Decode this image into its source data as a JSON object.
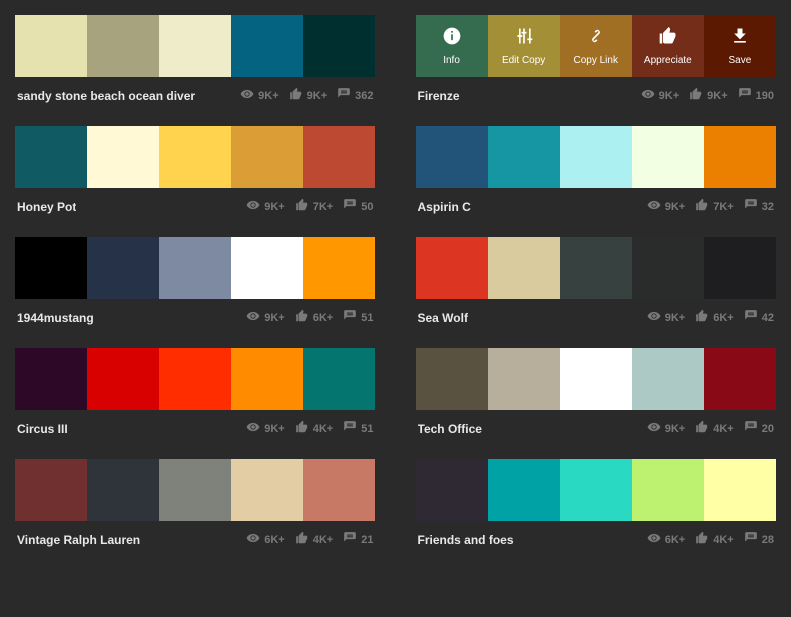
{
  "overlay": {
    "info": "Info",
    "edit": "Edit Copy",
    "copy": "Copy Link",
    "appreciate": "Appreciate",
    "save": "Save"
  },
  "palettes": [
    {
      "title": "sandy stone beach ocean diver",
      "views": "9K+",
      "likes": "9K+",
      "comments": "362",
      "colors": [
        "#e6e2af",
        "#a7a37e",
        "#efecca",
        "#046380",
        "#002f2f"
      ],
      "hover": false
    },
    {
      "title": "Firenze",
      "views": "9K+",
      "likes": "9K+",
      "comments": "190",
      "colors": [
        "#468966",
        "#fff0a5",
        "#ffb03b",
        "#b64926",
        "#8e2800"
      ],
      "hover": true,
      "ov_colors": [
        "#356b4e",
        "#a38f36",
        "#a06f24",
        "#732d18",
        "#5a1900"
      ]
    },
    {
      "title": "Honey Pot",
      "views": "9K+",
      "likes": "7K+",
      "comments": "50",
      "colors": [
        "#105b63",
        "#fffad5",
        "#ffd34e",
        "#db9e36",
        "#bd4932"
      ],
      "hover": false
    },
    {
      "title": "Aspirin C",
      "views": "9K+",
      "likes": "7K+",
      "comments": "32",
      "colors": [
        "#225378",
        "#1695a3",
        "#acf0f2",
        "#f3ffe2",
        "#eb7f00"
      ],
      "hover": false
    },
    {
      "title": "1944mustang",
      "views": "9K+",
      "likes": "6K+",
      "comments": "51",
      "colors": [
        "#000000",
        "#263248",
        "#7e8aa2",
        "#ffffff",
        "#ff9800"
      ],
      "hover": false
    },
    {
      "title": "Sea Wolf",
      "views": "9K+",
      "likes": "6K+",
      "comments": "42",
      "colors": [
        "#dc3522",
        "#d9cb9e",
        "#374140",
        "#2a2c2b",
        "#1e1e20"
      ],
      "hover": false
    },
    {
      "title": "Circus III",
      "views": "9K+",
      "likes": "4K+",
      "comments": "51",
      "colors": [
        "#2e0927",
        "#d90000",
        "#ff2d00",
        "#ff8c00",
        "#04756f"
      ],
      "hover": false
    },
    {
      "title": "Tech Office",
      "views": "9K+",
      "likes": "4K+",
      "comments": "20",
      "colors": [
        "#595241",
        "#b8ae9c",
        "#ffffff",
        "#acc9c6",
        "#8a0917"
      ],
      "hover": false
    },
    {
      "title": "Vintage Ralph Lauren",
      "views": "6K+",
      "likes": "4K+",
      "comments": "21",
      "colors": [
        "#703030",
        "#2f343b",
        "#7e827a",
        "#e3cda4",
        "#c77966"
      ],
      "hover": false
    },
    {
      "title": "Friends and foes",
      "views": "6K+",
      "likes": "4K+",
      "comments": "28",
      "colors": [
        "#2f2933",
        "#01a2a6",
        "#29d9c2",
        "#bdf271",
        "#ffffa6"
      ],
      "hover": false
    }
  ]
}
